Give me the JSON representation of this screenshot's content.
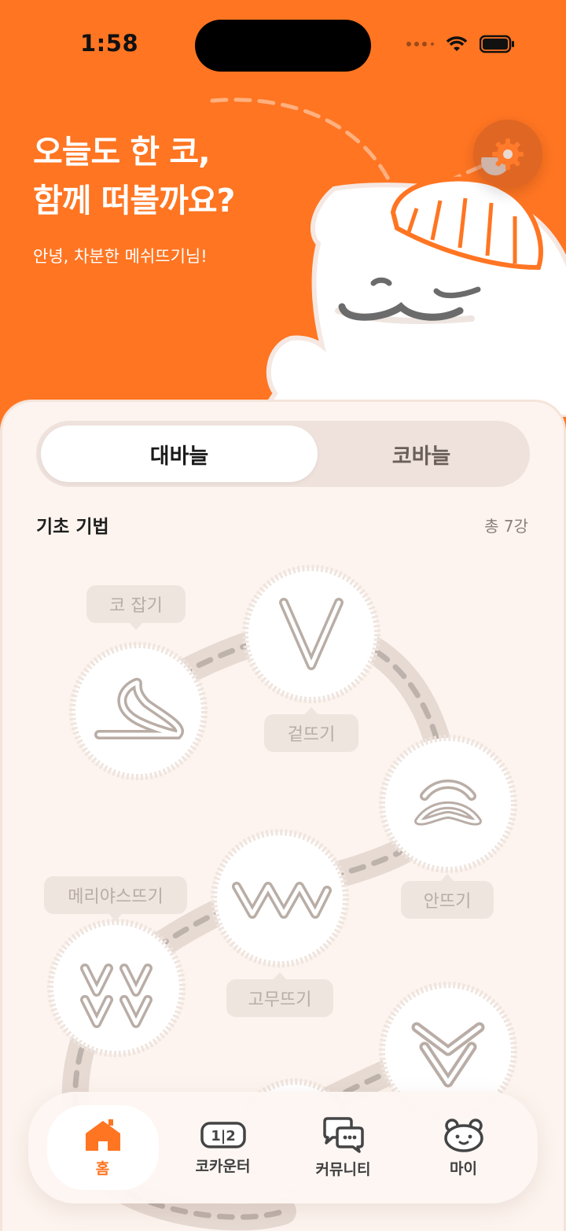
{
  "status_bar": {
    "time": "1:58"
  },
  "hero": {
    "title_line1": "오늘도 한 코,",
    "title_line2": "함께 떠볼까요?",
    "greeting": "안녕, 차분한 메쉬뜨기님!"
  },
  "segmented": {
    "tabs": [
      "대바늘",
      "코바늘"
    ],
    "selected": "대바늘"
  },
  "section": {
    "title": "기초 기법",
    "count": "총 7강"
  },
  "lessons": [
    {
      "label": "코 잡기",
      "icon": "loop-icon"
    },
    {
      "label": "겉뜨기",
      "icon": "v-stitch-icon"
    },
    {
      "label": "안뜨기",
      "icon": "purl-bump-icon"
    },
    {
      "label": "고무뜨기",
      "icon": "rib-wave-icon"
    },
    {
      "label": "메리야스뜨기",
      "icon": "stockinette-icon"
    },
    {
      "label": "",
      "icon": "double-v-icon"
    },
    {
      "label": "",
      "icon": "stitch-node-icon"
    }
  ],
  "tab_bar": {
    "items": [
      {
        "label": "홈",
        "icon": "home-icon",
        "active": true
      },
      {
        "label": "코카운터",
        "icon": "counter-icon",
        "active": false
      },
      {
        "label": "커뮤니티",
        "icon": "chat-bubbles-icon",
        "active": false
      },
      {
        "label": "마이",
        "icon": "bear-face-icon",
        "active": false
      }
    ]
  },
  "colors": {
    "accent": "#FF7522",
    "panel": "#FDF4EF",
    "label_bg": "#EEE5DF",
    "label_text": "#B8ACA6"
  }
}
